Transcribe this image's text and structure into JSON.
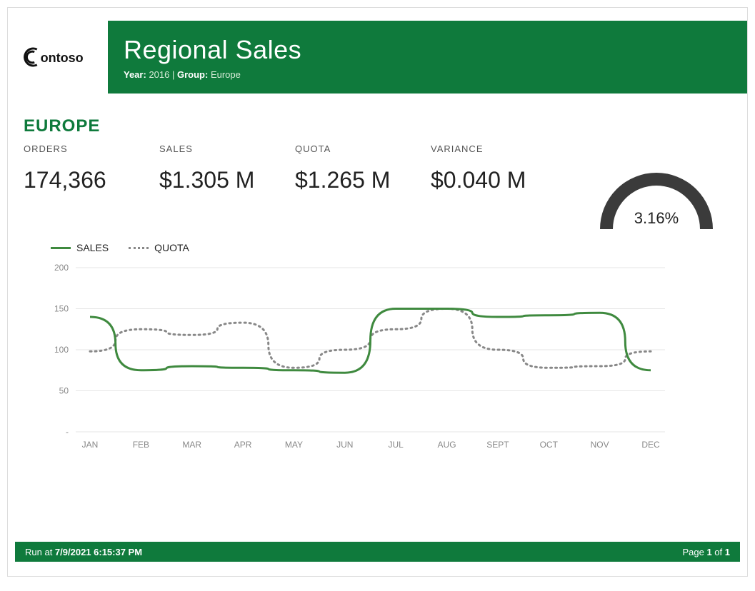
{
  "brand": "Contoso",
  "header": {
    "title": "Regional Sales",
    "year_label": "Year:",
    "year_value": "2016",
    "group_label": "Group:",
    "group_value": "Europe"
  },
  "region_title": "EUROPE",
  "kpis": {
    "orders": {
      "label": "ORDERS",
      "value": "174,366"
    },
    "sales": {
      "label": "SALES",
      "value": "$1.305 M"
    },
    "quota": {
      "label": "QUOTA",
      "value": "$1.265 M"
    },
    "variance": {
      "label": "VARIANCE",
      "value": "$0.040 M"
    }
  },
  "gauge": {
    "value_label": "3.16%",
    "percent": 3.16,
    "color": "#3b3b3b"
  },
  "legend": {
    "sales": "SALES",
    "quota": "QUOTA"
  },
  "chart_data": {
    "type": "line",
    "title": "",
    "xlabel": "",
    "ylabel": "",
    "ylim": [
      0,
      200
    ],
    "y_ticks": [
      0,
      50,
      100,
      150,
      200
    ],
    "y_tick_labels": [
      "-",
      "50",
      "100",
      "150",
      "200"
    ],
    "categories": [
      "JAN",
      "FEB",
      "MAR",
      "APR",
      "MAY",
      "JUN",
      "JUL",
      "AUG",
      "SEPT",
      "OCT",
      "NOV",
      "DEC"
    ],
    "series": [
      {
        "name": "SALES",
        "values": [
          140,
          75,
          80,
          78,
          75,
          72,
          150,
          150,
          140,
          142,
          145,
          75
        ]
      },
      {
        "name": "QUOTA",
        "values": [
          98,
          125,
          118,
          133,
          78,
          100,
          125,
          150,
          100,
          78,
          80,
          98
        ]
      }
    ]
  },
  "footer": {
    "run_at_label": "Run at ",
    "run_at_value": "7/9/2021 6:15:37 PM",
    "page_label_prefix": "Page ",
    "page_current": "1",
    "page_of": " of ",
    "page_total": "1"
  },
  "colors": {
    "brand_green": "#0f7a3c",
    "line_green": "#3f8a3f",
    "gray": "#888888"
  }
}
